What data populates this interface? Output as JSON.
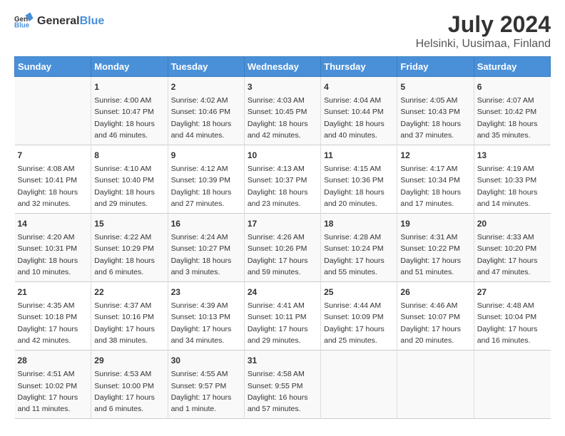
{
  "header": {
    "logo_general": "General",
    "logo_blue": "Blue",
    "title": "July 2024",
    "subtitle": "Helsinki, Uusimaa, Finland"
  },
  "weekdays": [
    "Sunday",
    "Monday",
    "Tuesday",
    "Wednesday",
    "Thursday",
    "Friday",
    "Saturday"
  ],
  "weeks": [
    [
      {
        "day": "",
        "info": ""
      },
      {
        "day": "1",
        "info": "Sunrise: 4:00 AM\nSunset: 10:47 PM\nDaylight: 18 hours\nand 46 minutes."
      },
      {
        "day": "2",
        "info": "Sunrise: 4:02 AM\nSunset: 10:46 PM\nDaylight: 18 hours\nand 44 minutes."
      },
      {
        "day": "3",
        "info": "Sunrise: 4:03 AM\nSunset: 10:45 PM\nDaylight: 18 hours\nand 42 minutes."
      },
      {
        "day": "4",
        "info": "Sunrise: 4:04 AM\nSunset: 10:44 PM\nDaylight: 18 hours\nand 40 minutes."
      },
      {
        "day": "5",
        "info": "Sunrise: 4:05 AM\nSunset: 10:43 PM\nDaylight: 18 hours\nand 37 minutes."
      },
      {
        "day": "6",
        "info": "Sunrise: 4:07 AM\nSunset: 10:42 PM\nDaylight: 18 hours\nand 35 minutes."
      }
    ],
    [
      {
        "day": "7",
        "info": "Sunrise: 4:08 AM\nSunset: 10:41 PM\nDaylight: 18 hours\nand 32 minutes."
      },
      {
        "day": "8",
        "info": "Sunrise: 4:10 AM\nSunset: 10:40 PM\nDaylight: 18 hours\nand 29 minutes."
      },
      {
        "day": "9",
        "info": "Sunrise: 4:12 AM\nSunset: 10:39 PM\nDaylight: 18 hours\nand 27 minutes."
      },
      {
        "day": "10",
        "info": "Sunrise: 4:13 AM\nSunset: 10:37 PM\nDaylight: 18 hours\nand 23 minutes."
      },
      {
        "day": "11",
        "info": "Sunrise: 4:15 AM\nSunset: 10:36 PM\nDaylight: 18 hours\nand 20 minutes."
      },
      {
        "day": "12",
        "info": "Sunrise: 4:17 AM\nSunset: 10:34 PM\nDaylight: 18 hours\nand 17 minutes."
      },
      {
        "day": "13",
        "info": "Sunrise: 4:19 AM\nSunset: 10:33 PM\nDaylight: 18 hours\nand 14 minutes."
      }
    ],
    [
      {
        "day": "14",
        "info": "Sunrise: 4:20 AM\nSunset: 10:31 PM\nDaylight: 18 hours\nand 10 minutes."
      },
      {
        "day": "15",
        "info": "Sunrise: 4:22 AM\nSunset: 10:29 PM\nDaylight: 18 hours\nand 6 minutes."
      },
      {
        "day": "16",
        "info": "Sunrise: 4:24 AM\nSunset: 10:27 PM\nDaylight: 18 hours\nand 3 minutes."
      },
      {
        "day": "17",
        "info": "Sunrise: 4:26 AM\nSunset: 10:26 PM\nDaylight: 17 hours\nand 59 minutes."
      },
      {
        "day": "18",
        "info": "Sunrise: 4:28 AM\nSunset: 10:24 PM\nDaylight: 17 hours\nand 55 minutes."
      },
      {
        "day": "19",
        "info": "Sunrise: 4:31 AM\nSunset: 10:22 PM\nDaylight: 17 hours\nand 51 minutes."
      },
      {
        "day": "20",
        "info": "Sunrise: 4:33 AM\nSunset: 10:20 PM\nDaylight: 17 hours\nand 47 minutes."
      }
    ],
    [
      {
        "day": "21",
        "info": "Sunrise: 4:35 AM\nSunset: 10:18 PM\nDaylight: 17 hours\nand 42 minutes."
      },
      {
        "day": "22",
        "info": "Sunrise: 4:37 AM\nSunset: 10:16 PM\nDaylight: 17 hours\nand 38 minutes."
      },
      {
        "day": "23",
        "info": "Sunrise: 4:39 AM\nSunset: 10:13 PM\nDaylight: 17 hours\nand 34 minutes."
      },
      {
        "day": "24",
        "info": "Sunrise: 4:41 AM\nSunset: 10:11 PM\nDaylight: 17 hours\nand 29 minutes."
      },
      {
        "day": "25",
        "info": "Sunrise: 4:44 AM\nSunset: 10:09 PM\nDaylight: 17 hours\nand 25 minutes."
      },
      {
        "day": "26",
        "info": "Sunrise: 4:46 AM\nSunset: 10:07 PM\nDaylight: 17 hours\nand 20 minutes."
      },
      {
        "day": "27",
        "info": "Sunrise: 4:48 AM\nSunset: 10:04 PM\nDaylight: 17 hours\nand 16 minutes."
      }
    ],
    [
      {
        "day": "28",
        "info": "Sunrise: 4:51 AM\nSunset: 10:02 PM\nDaylight: 17 hours\nand 11 minutes."
      },
      {
        "day": "29",
        "info": "Sunrise: 4:53 AM\nSunset: 10:00 PM\nDaylight: 17 hours\nand 6 minutes."
      },
      {
        "day": "30",
        "info": "Sunrise: 4:55 AM\nSunset: 9:57 PM\nDaylight: 17 hours\nand 1 minute."
      },
      {
        "day": "31",
        "info": "Sunrise: 4:58 AM\nSunset: 9:55 PM\nDaylight: 16 hours\nand 57 minutes."
      },
      {
        "day": "",
        "info": ""
      },
      {
        "day": "",
        "info": ""
      },
      {
        "day": "",
        "info": ""
      }
    ]
  ]
}
